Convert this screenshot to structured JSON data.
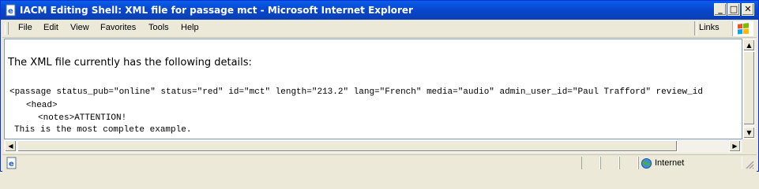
{
  "window": {
    "title": "IACM Editing Shell: XML file for passage mct - Microsoft Internet Explorer",
    "minimize_label": "_",
    "maximize_label": "□",
    "close_label": "✕",
    "title_color": "#0a5ee8"
  },
  "menubar": {
    "items": [
      {
        "label": "File"
      },
      {
        "label": "Edit"
      },
      {
        "label": "View"
      },
      {
        "label": "Favorites"
      },
      {
        "label": "Tools"
      },
      {
        "label": "Help"
      }
    ],
    "links_label": "Links"
  },
  "content": {
    "heading": "The XML file currently has the following details:",
    "xml_lines": [
      "<passage status_pub=\"online\" status=\"red\" id=\"mct\" length=\"213.2\" lang=\"French\" media=\"audio\" admin_user_id=\"Paul Trafford\" review_id",
      "<head>",
      "<notes>ATTENTION!",
      "This is the most complete example."
    ]
  },
  "statusbar": {
    "zone_label": "Internet"
  },
  "icons": {
    "app": "ie-page-icon",
    "windows_logo": "windows-logo-icon",
    "status_page": "page-done-icon",
    "zone": "internet-zone-icon"
  }
}
